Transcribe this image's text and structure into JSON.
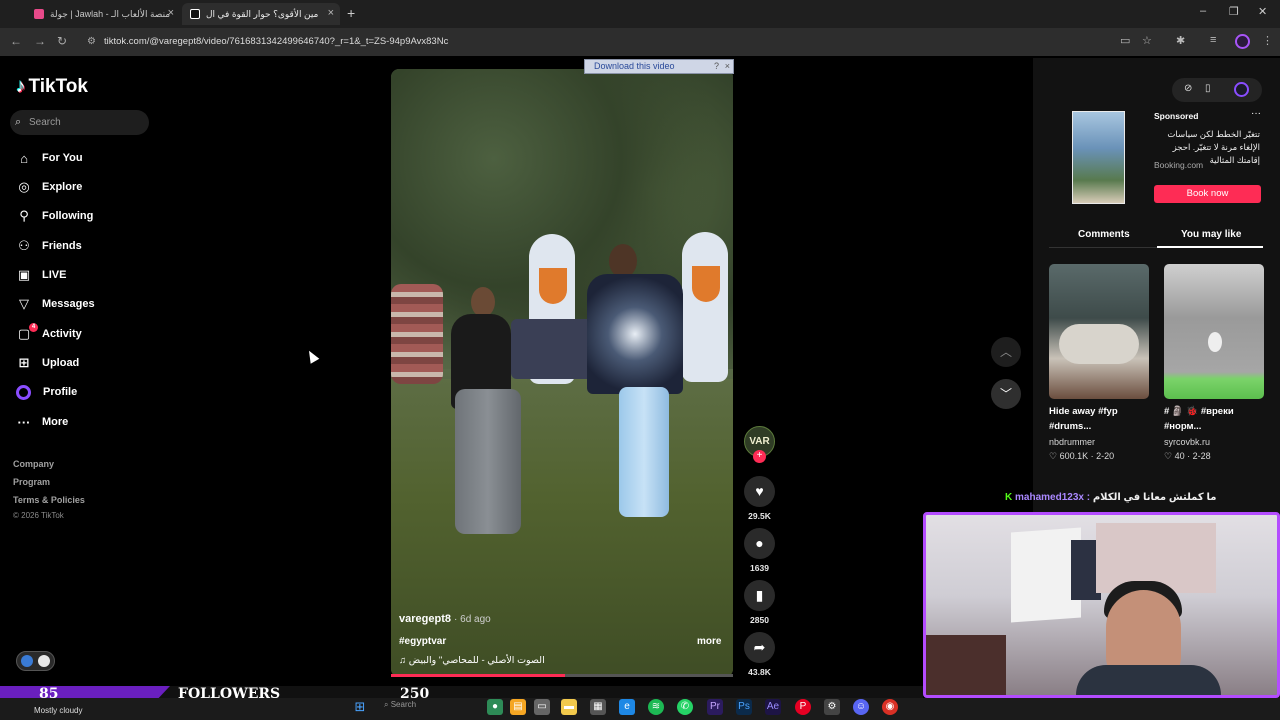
{
  "browser": {
    "tabs": [
      {
        "label": "جولة | Jawlah - منصة الألعاب الـ"
      },
      {
        "label": "مين الأقوى؟ حوار القوة في ال"
      }
    ],
    "url": "tiktok.com/@varegept8/video/7616831342499646740?_r=1&_t=ZS-94p9Avx83Nc"
  },
  "download_bar": {
    "label": "Download this video",
    "help": "?",
    "close": "×"
  },
  "sidebar": {
    "logo": "TikTok",
    "search_placeholder": "Search",
    "nav": [
      {
        "label": "For You",
        "icon": "home-icon"
      },
      {
        "label": "Explore",
        "icon": "compass-icon"
      },
      {
        "label": "Following",
        "icon": "following-icon"
      },
      {
        "label": "Friends",
        "icon": "friends-icon"
      },
      {
        "label": "LIVE",
        "icon": "live-icon"
      },
      {
        "label": "Messages",
        "icon": "messages-icon"
      },
      {
        "label": "Activity",
        "icon": "activity-icon",
        "badge": "4"
      },
      {
        "label": "Upload",
        "icon": "upload-icon"
      },
      {
        "label": "Profile",
        "icon": "profile-icon"
      },
      {
        "label": "More",
        "icon": "more-icon"
      }
    ],
    "footer": [
      "Company",
      "Program",
      "Terms & Policies"
    ],
    "copyright": "© 2026 TikTok"
  },
  "video": {
    "author": "varegept8",
    "age": "· 6d ago",
    "hashtag": "#egyptvar",
    "more": "more",
    "sound": "الصوت الأصلي - للمحاصي\" والبيض",
    "progress": 0.51
  },
  "actions": {
    "avatar_text": "VAR",
    "likes": "29.5K",
    "comments": "1639",
    "saves": "2850",
    "shares": "43.8K"
  },
  "ad": {
    "sponsored": "Sponsored",
    "text": "تتغيّر الخطط لكن سياسات الإلغاء مرنة لا تتغيّر. احجز إقامتك المثالية",
    "source": "Booking.com",
    "cta": "Book now"
  },
  "right_tabs": {
    "comments": "Comments",
    "you_may_like": "You may like"
  },
  "recommended": [
    {
      "title": "Hide away #fyp #drums...",
      "author": "nbdrummer",
      "stats": "♡ 600.1K · 2-20"
    },
    {
      "title": "# 🗿 🐞 #вреки #норм...",
      "author": "syrcovbk.ru",
      "stats": "♡ 40 · 2-28"
    }
  ],
  "stream": {
    "chat_prefix": "K",
    "chat_name": "mahamed123x :",
    "chat_text": "ما كملتش معانا في الكلام",
    "followers_count": "85",
    "followers_label": "FOLLOWERS",
    "followers_goal": "250"
  },
  "taskbar": {
    "weather": "Mostly cloudy",
    "search": "Search"
  }
}
